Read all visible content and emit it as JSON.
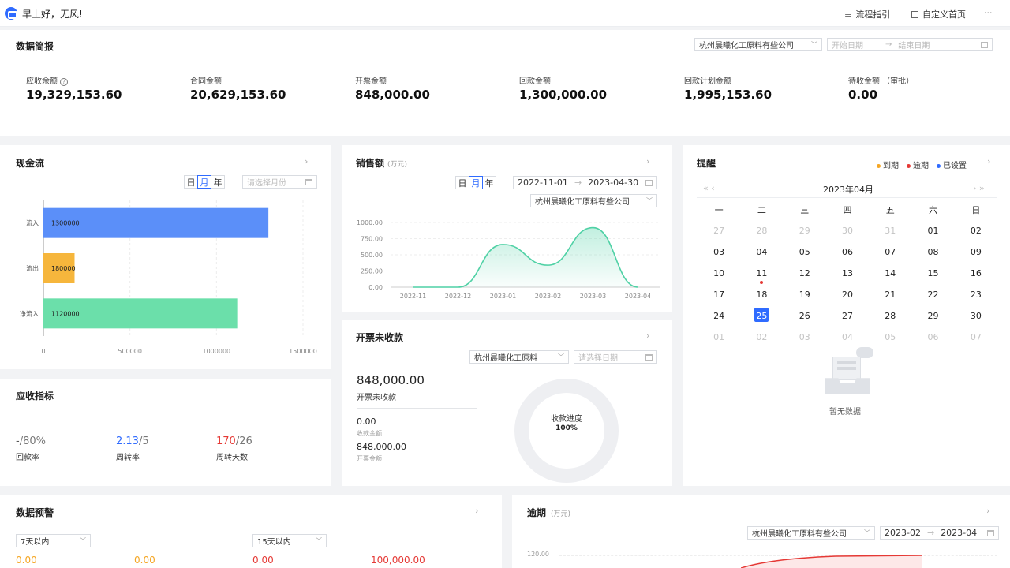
{
  "topbar": {
    "greeting": "早上好，无风!",
    "flow_guide": "流程指引",
    "custom_home": "自定义首页",
    "more": "···"
  },
  "brief": {
    "title": "数据简报",
    "company": "杭州晨曦化工原料有些公司",
    "start_placeholder": "开始日期",
    "end_placeholder": "结束日期",
    "arrow": "→",
    "metrics": [
      {
        "label": "应收余额",
        "value": "19,329,153.60"
      },
      {
        "label": "合同金额",
        "value": "20,629,153.60"
      },
      {
        "label": "开票金额",
        "value": "848,000.00"
      },
      {
        "label": "回款金额",
        "value": "1,300,000.00"
      },
      {
        "label": "回款计划金额",
        "value": "1,995,153.60"
      },
      {
        "label": "待收金额 （审批）",
        "value": "0.00"
      }
    ]
  },
  "cashflow": {
    "title": "现金流",
    "tabs": [
      "日",
      "月",
      "年"
    ],
    "month_placeholder": "请选择月份",
    "chart_data": {
      "type": "bar",
      "orientation": "horizontal",
      "categories": [
        "流入",
        "流出",
        "净流入"
      ],
      "values": [
        1300000,
        180000,
        1120000
      ],
      "value_labels": [
        "1300000",
        "180000",
        "1120000"
      ],
      "colors": [
        "#5b8ff9",
        "#f6b63c",
        "#6bdfaa"
      ],
      "xlim": [
        0,
        1500000
      ],
      "xticks": [
        "0",
        "500000",
        "1000000",
        "1500000"
      ],
      "grid": true
    }
  },
  "sales": {
    "title": "销售额",
    "unit": "(万元)",
    "tabs": [
      "日",
      "月",
      "年"
    ],
    "start": "2022-11-01",
    "end": "2023-04-30",
    "arrow": "→",
    "company": "杭州晨曦化工原料有些公司",
    "chart_data": {
      "type": "area",
      "x": [
        "2022-11",
        "2022-12",
        "2023-01",
        "2023-02",
        "2023-03",
        "2023-04"
      ],
      "y": [
        0,
        0,
        660,
        340,
        920,
        0
      ],
      "ylim": [
        0,
        1000
      ],
      "yticks": [
        "0.00",
        "250.00",
        "500.00",
        "750.00",
        "1000.00"
      ],
      "color": "#4fd1a5",
      "grid": true
    }
  },
  "reminder": {
    "title": "提醒",
    "legend": [
      {
        "label": "到期",
        "color": "#f5a623"
      },
      {
        "label": "逾期",
        "color": "#e53935"
      },
      {
        "label": "已设置",
        "color": "#2f6bff"
      }
    ],
    "month": "2023年04月",
    "nav_prev": "« ‹",
    "nav_next": "› »",
    "weekdays": [
      "一",
      "二",
      "三",
      "四",
      "五",
      "六",
      "日"
    ],
    "weeks": [
      [
        "27",
        "28",
        "29",
        "30",
        "31",
        "01",
        "02"
      ],
      [
        "03",
        "04",
        "05",
        "06",
        "07",
        "08",
        "09"
      ],
      [
        "10",
        "11",
        "12",
        "13",
        "14",
        "15",
        "16"
      ],
      [
        "17",
        "18",
        "19",
        "20",
        "21",
        "22",
        "23"
      ],
      [
        "24",
        "25",
        "26",
        "27",
        "28",
        "29",
        "30"
      ],
      [
        "01",
        "02",
        "03",
        "04",
        "05",
        "06",
        "07"
      ]
    ],
    "empty_text": "暂无数据"
  },
  "receivable": {
    "title": "应收指标",
    "items": [
      {
        "value": "-",
        "target": "/80%",
        "label": "回款率",
        "color": "#555"
      },
      {
        "value": "2.13",
        "target": "/5",
        "label": "周转率",
        "color": "#2f6bff"
      },
      {
        "value": "170",
        "target": "/26",
        "label": "周转天数",
        "color": "#e53935"
      }
    ]
  },
  "invoice": {
    "title": "开票未收款",
    "company": "杭州晨曦化工原料",
    "date_placeholder": "请选择日期",
    "amount": "848,000.00",
    "amount_label": "开票未收款",
    "received": "0.00",
    "received_label": "收款金额",
    "invoiced": "848,000.00",
    "invoiced_label": "开票金额",
    "progress_label": "收款进度",
    "progress_value": "100%"
  },
  "warning": {
    "title": "数据预警",
    "select1": "7天以内",
    "select2": "15天以内",
    "values": [
      "0.00",
      "0.00",
      "0.00",
      "100,000.00"
    ]
  },
  "overdue": {
    "title": "逾期",
    "unit": "(万元)",
    "company": "杭州晨曦化工原料有些公司",
    "start": "2023-02",
    "end": "2023-04",
    "arrow": "→",
    "top_tick": "120.00"
  }
}
